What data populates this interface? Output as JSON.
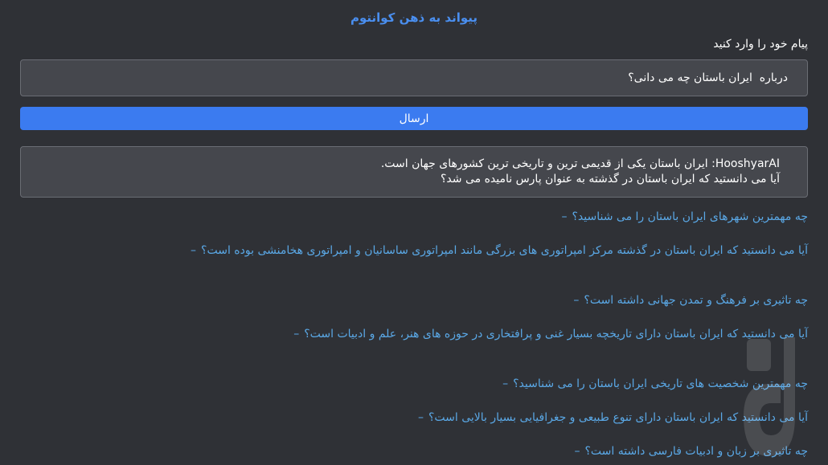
{
  "header": {
    "title": "پیواند به ذهن کوانتوم"
  },
  "form": {
    "prompt_label": "پیام خود را وارد کنید",
    "input_value": "درباره  ایران باستان چه می دانی؟",
    "send_label": "ارسال"
  },
  "response": {
    "line1": "HooshyarAI: ایران باستان یکی از قدیمی ترین و تاریخی ترین کشورهای جهان است.",
    "line2": "آیا می دانستید که ایران باستان در گذشته به عنوان پارس نامیده می شد؟"
  },
  "suggestions": [
    "چه مهمترین شهرهای ایران باستان را می شناسید؟",
    "آیا می دانستید که ایران باستان در گذشته مرکز امپراتوری های بزرگی مانند امپراتوری ساسانیان و امپراتوری هخامنشی بوده است؟",
    "چه تاثیری بر فرهنگ و تمدن جهانی داشته است؟",
    "آیا می دانستید که ایران باستان دارای تاریخچه بسیار غنی و پرافتخاری در حوزه های هنر، علم و ادبیات است؟",
    "چه مهمترین شخصیت های تاریخی ایران باستان را می شناسید؟",
    "آیا می دانستید که ایران باستان دارای تنوع طبیعی و جغرافیایی بسیار بالایی است؟",
    "چه تاثیری بر زبان و ادبیات فارسی داشته است؟"
  ],
  "suggestion_bullet": "–",
  "colors": {
    "background": "#2f3136",
    "accent": "#3b7bf0",
    "title": "#4a8ff0",
    "link": "#5aa8e6"
  },
  "watermark_icon": "bazaar-logo-icon"
}
